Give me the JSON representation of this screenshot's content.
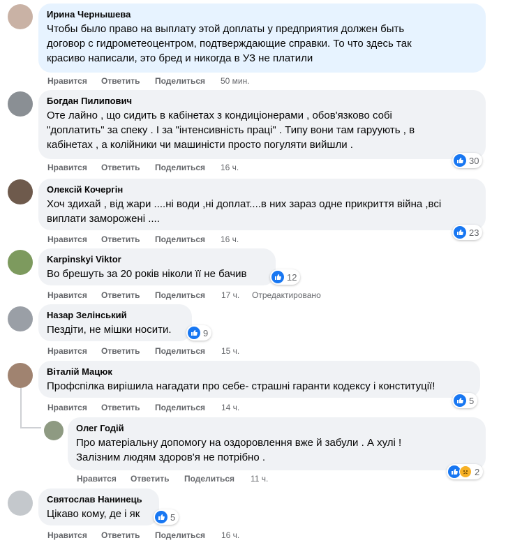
{
  "actions": {
    "like": "Нравится",
    "reply": "Ответить",
    "share": "Поделиться"
  },
  "comments": [
    {
      "author": "Ирина Чернышева",
      "lines": [
        "Чтобы было право на выплату этой доплаты у предприятия должен быть",
        "договор с гидрометеоцентром, подтверждающие справки. То что здесь так",
        "красиво написали, это бред и никогда в УЗ не платили"
      ],
      "time": "50 мин.",
      "reactions": ""
    },
    {
      "author": "Богдан Пилипович",
      "lines": [
        "Оте лайно , що сидить в кабінетах з кондиціонерами , обов'язково собі",
        "\"доплатить\" за спеку . І за \"інтенсивність праці\" . Типу вони там гаруують , в",
        "кабінетах , а колійники чи машиністи просто погуляти вийшли ."
      ],
      "time": "16 ч.",
      "reactions": "30"
    },
    {
      "author": "Олексій Кочергін",
      "lines": [
        "Хоч здихай , від жари ....ні води ,ні доплат....в них зараз одне прикриття війна ,всі",
        "виплати заморожені ...."
      ],
      "time": "16 ч.",
      "reactions": "23"
    },
    {
      "author": "Karpinskyi Viktor",
      "lines": [
        "Во брешуть за 20 років ніколи її не бачив"
      ],
      "time": "17 ч.",
      "edited": "Отредактировано",
      "reactions": "12"
    },
    {
      "author": "Назар Зелінський",
      "lines": [
        "Пездіти, не мішки носити."
      ],
      "time": "15 ч.",
      "reactions": "9"
    },
    {
      "author": "Віталій Мацюк",
      "lines": [
        "Профспілка вирішила нагадати про себе- страшні гаранти кодексу і конституції!"
      ],
      "time": "14 ч.",
      "reactions": "5"
    },
    {
      "author": "Олег Годій",
      "lines": [
        "Про матеріальну допомогу на оздоровлення вже й забули . А хулі !",
        "Залізним людям здоров'я не потрібно ."
      ],
      "time": "11 ч.",
      "reactions": "2"
    },
    {
      "author": "Святослав Нанинець",
      "lines": [
        "Цікаво кому, де і як"
      ],
      "time": "16 ч.",
      "reactions": "5"
    }
  ],
  "icons": {
    "like": "like-icon",
    "sad": "sad-icon"
  },
  "colors": {
    "bubble": "#f0f2f5",
    "highlight": "#e7f3ff",
    "like": "#1877f2",
    "meta": "#65676b"
  }
}
